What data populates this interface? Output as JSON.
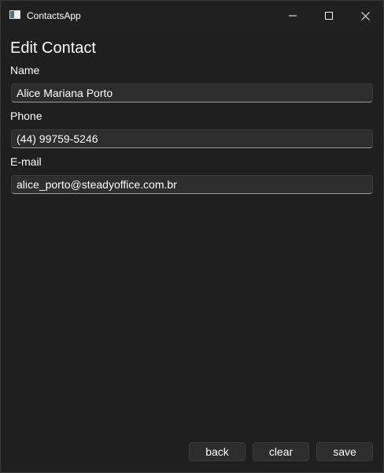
{
  "window": {
    "title": "ContactsApp",
    "icon": "app-window-icon",
    "controls": {
      "minimize_icon": "minimize-icon",
      "maximize_icon": "maximize-icon",
      "close_icon": "close-icon"
    }
  },
  "form": {
    "heading": "Edit Contact",
    "fields": [
      {
        "label": "Name",
        "value": "Alice Mariana Porto"
      },
      {
        "label": "Phone",
        "value": "(44) 99759-5246"
      },
      {
        "label": "E-mail",
        "value": "alice_porto@steadyoffice.com.br"
      }
    ]
  },
  "actions": {
    "back_label": "back",
    "clear_label": "clear",
    "save_label": "save"
  },
  "colors": {
    "background": "#202020",
    "input_background": "#2d2d2d",
    "input_underline": "#9a9a9a",
    "text": "#ffffff"
  }
}
